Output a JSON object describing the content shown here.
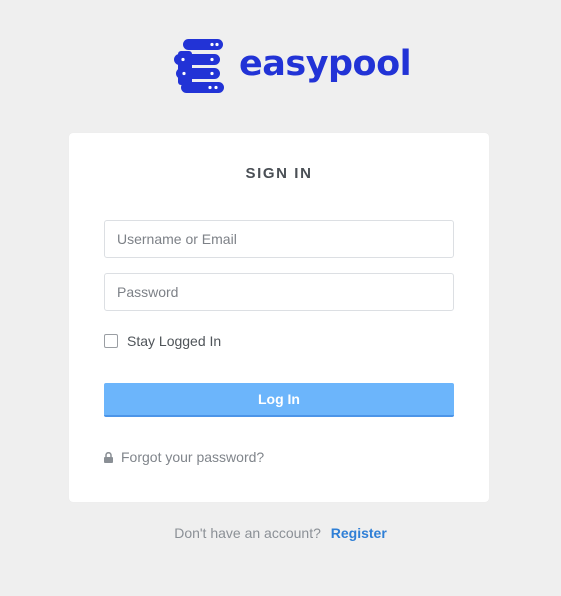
{
  "brand": {
    "name": "easypool",
    "color": "#2233d6",
    "icon": "easypool-logo-icon"
  },
  "login": {
    "title": "SIGN IN",
    "username_placeholder": "Username or Email",
    "password_placeholder": "Password",
    "remember_label": "Stay Logged In",
    "submit_label": "Log In",
    "forgot_label": "Forgot your password?",
    "forgot_icon": "lock-icon"
  },
  "signup": {
    "prompt": "Don't have an account?",
    "link_label": "Register"
  },
  "colors": {
    "background": "#efefef",
    "button": "#6cb5fb",
    "link": "#2f7fd6"
  }
}
